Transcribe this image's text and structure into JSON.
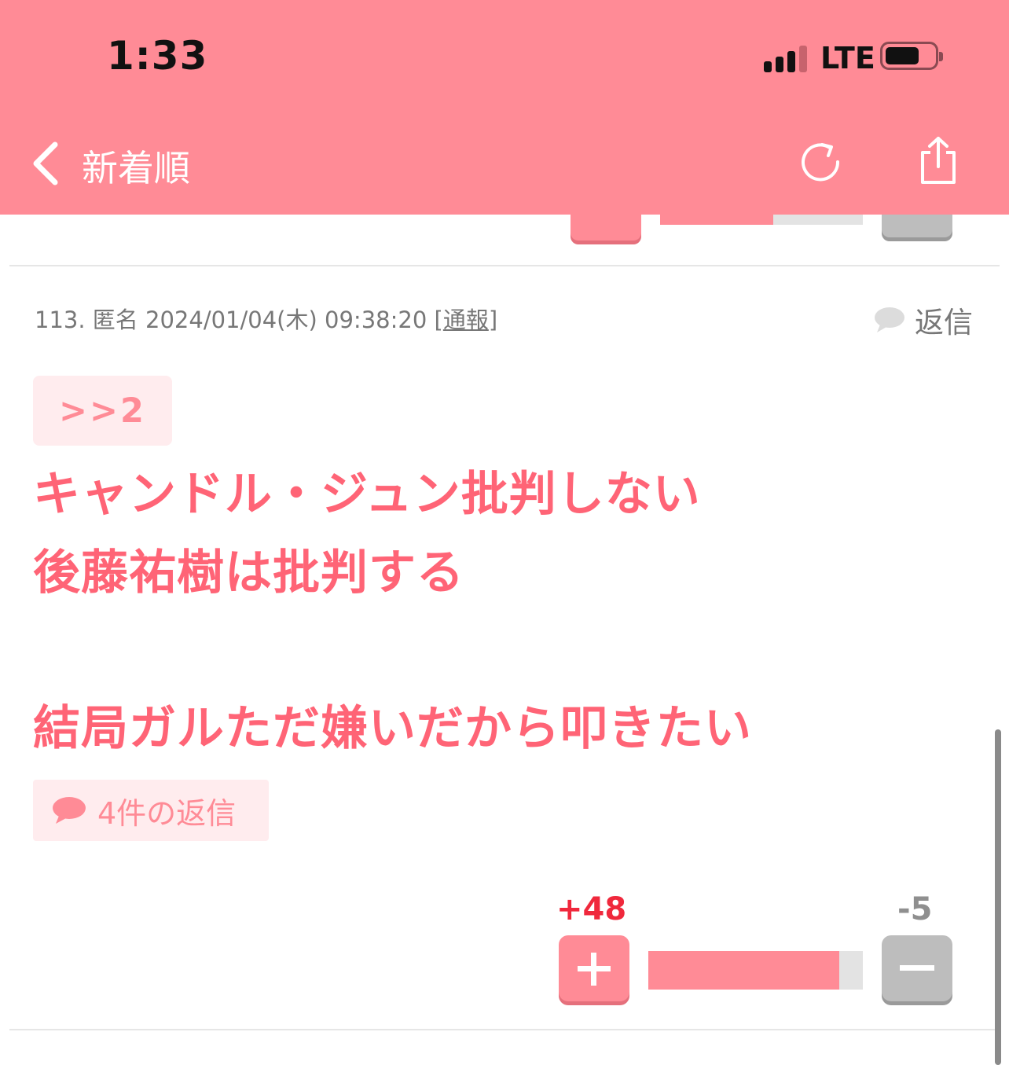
{
  "status_bar": {
    "time": "1:33",
    "network": "LTE",
    "signal_bars_active": 3,
    "signal_bars_total": 4
  },
  "nav": {
    "back_icon": "chevron-left-icon",
    "title": "新着順",
    "refresh_icon": "refresh-icon",
    "share_icon": "share-icon"
  },
  "previous_post": {
    "vote_ratio_plus": 0.56
  },
  "comment": {
    "number": "113.",
    "author": "匿名",
    "datetime": "2024/01/04(木) 09:38:20",
    "report_open": "[",
    "report_label": "通報",
    "report_close": "]",
    "reply_label": "返信",
    "anchor": ">>2",
    "body_lines": [
      "キャンドル・ジュン批判しない",
      "後藤祐樹は批判する",
      "結局ガルただ嫌いだから叩きたい"
    ],
    "replies_label": "4件の返信",
    "plus_votes": "+48",
    "minus_votes": "-5",
    "vote_ratio_plus": 0.89
  },
  "colors": {
    "accent": "#ff8b96",
    "text_pink": "#ff6476",
    "plus_red": "#f0283c"
  }
}
